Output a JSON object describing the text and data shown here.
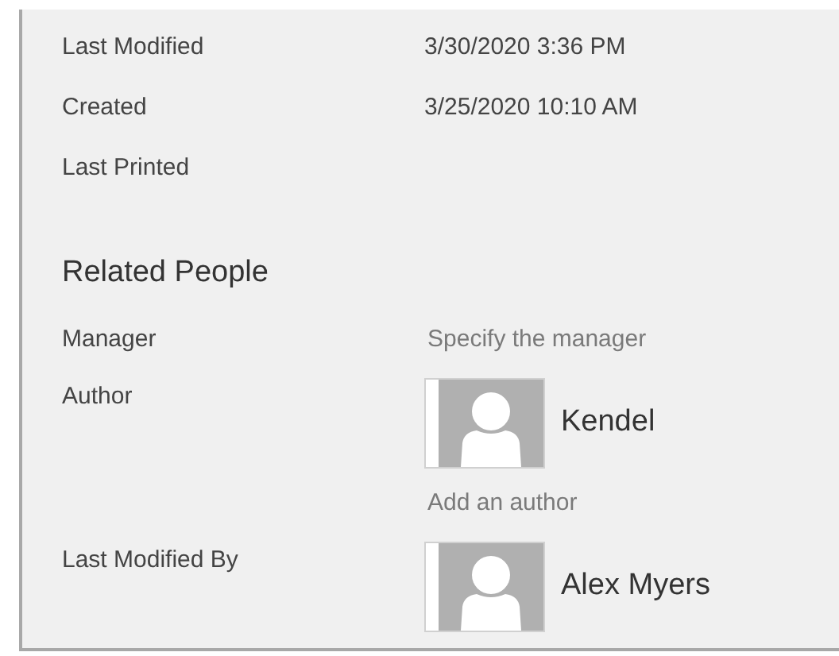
{
  "dates": [
    {
      "label": "Last Modified",
      "value": "3/30/2020 3:36 PM"
    },
    {
      "label": "Created",
      "value": "3/25/2020 10:10 AM"
    },
    {
      "label": "Last Printed"
    }
  ],
  "related_people": {
    "title": "Related People",
    "rows": [
      {
        "label": "Manager",
        "kind": "placeholder",
        "text": "Specify the manager"
      },
      {
        "label": "Author",
        "kind": "people",
        "people": [
          {
            "name": "Kendel"
          }
        ],
        "add_link": "Add an author"
      },
      {
        "label": "Last Modified By",
        "kind": "people",
        "people": [
          {
            "name": "Alex Myers"
          }
        ]
      }
    ]
  }
}
